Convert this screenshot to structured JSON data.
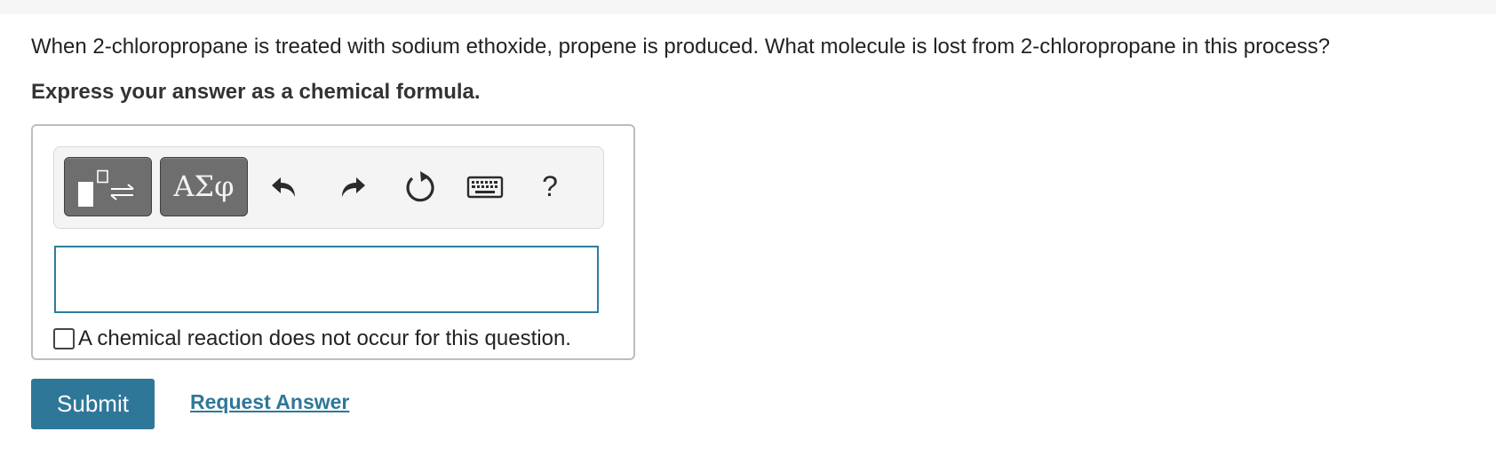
{
  "question": {
    "text": "When 2-chloropropane is treated with sodium ethoxide, propene is produced. What molecule is lost from 2-chloropropane in this process?",
    "instruction": "Express your answer as a chemical formula."
  },
  "toolbar": {
    "templates_icon": "templates-icon",
    "symbols_label": "ΑΣφ",
    "undo_icon": "undo-icon",
    "redo_icon": "redo-icon",
    "reset_icon": "reset-icon",
    "keyboard_icon": "keyboard-icon",
    "help_label": "?"
  },
  "answer": {
    "value": "",
    "no_reaction_label": "A chemical reaction does not occur for this question.",
    "no_reaction_checked": false
  },
  "actions": {
    "submit_label": "Submit",
    "request_answer_label": "Request Answer"
  },
  "colors": {
    "accent": "#2e7799",
    "input_border": "#2c7e9e",
    "toolbar_button": "#6e6e6e"
  }
}
